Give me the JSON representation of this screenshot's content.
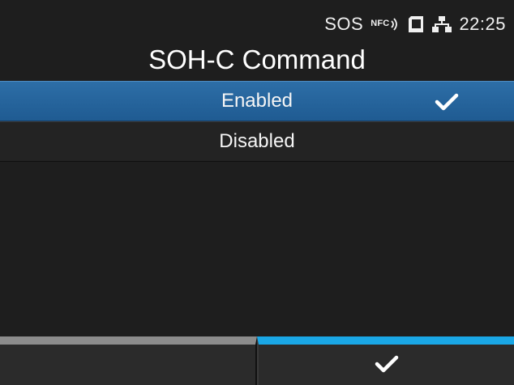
{
  "status_bar": {
    "sos": "SOS",
    "nfc": "NFC",
    "time": "22:25"
  },
  "title": "SOH-C Command",
  "options": [
    {
      "label": "Enabled",
      "selected": true
    },
    {
      "label": "Disabled",
      "selected": false
    }
  ],
  "softkeys": {
    "left_label": "",
    "right_icon": "checkmark-icon"
  },
  "colors": {
    "selected_bg": "#2366a0",
    "confirm_accent": "#1aa7e6",
    "left_accent": "#8c8c8c"
  }
}
